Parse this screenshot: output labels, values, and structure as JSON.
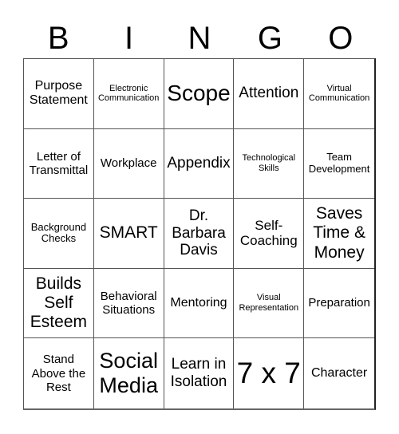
{
  "header": {
    "letters": [
      "B",
      "I",
      "N",
      "G",
      "O"
    ]
  },
  "cells": [
    "Purpose Statement",
    "Electronic Communication",
    "Scope",
    "Attention",
    "Virtual Communication",
    "Letter of Transmittal",
    "Workplace",
    "Appendix",
    "Technological Skills",
    "Team Development",
    "Background Checks",
    "SMART",
    "Dr. Barbara Davis",
    "Self-Coaching",
    "Saves Time & Money",
    "Builds Self Esteem",
    "Behavioral Situations",
    "Mentoring",
    "Visual Representation",
    "Preparation",
    "Stand Above the Rest",
    "Social Media",
    "Learn in Isolation",
    "7 x 7",
    "Character"
  ]
}
